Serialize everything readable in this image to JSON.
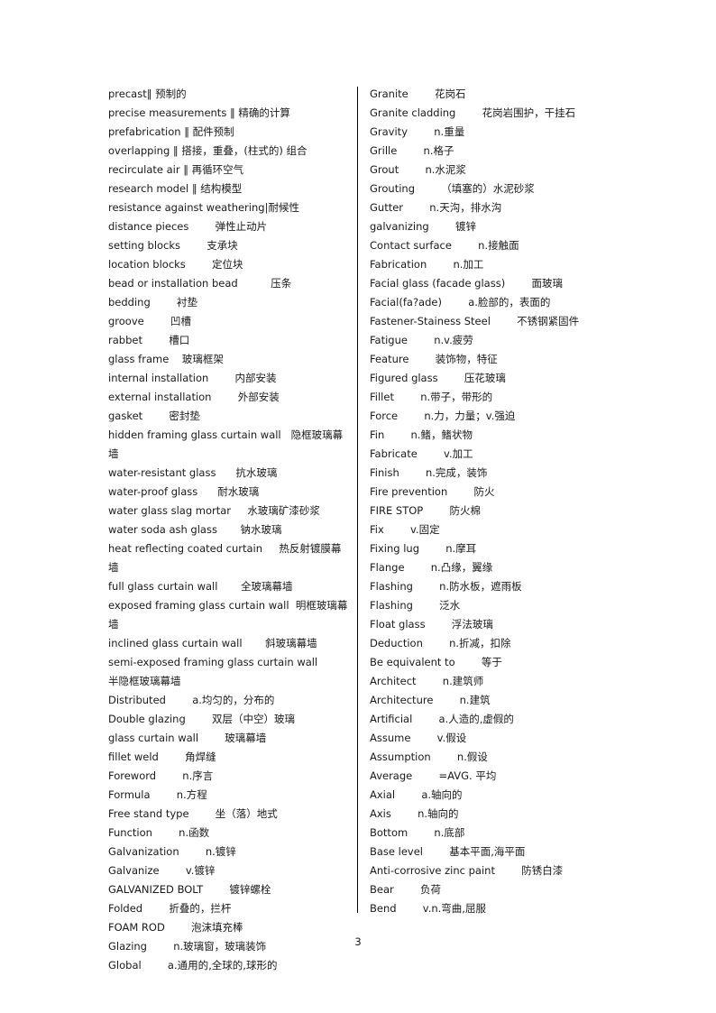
{
  "document": {
    "page_number": "3",
    "columns": {
      "left": [
        "precast‖ 预制的",
        "precise measurements ‖ 精确的计算",
        "prefabrication ‖ 配件预制",
        "overlapping ‖ 搭接，重叠，(柱式的) 组合",
        "recirculate air ‖ 再循环空气",
        "research model ‖ 结构模型",
        "resistance against weathering|耐候性",
        "distance pieces        弹性止动片",
        "setting blocks        支承块",
        "location blocks        定位块",
        "bead or installation bead          压条",
        "bedding        衬垫",
        "groove        凹槽",
        "rabbet        槽口",
        "glass frame    玻璃框架",
        "internal installation        内部安装",
        "external installation        外部安装",
        "gasket        密封垫",
        "hidden framing glass curtain wall   隐框玻璃幕墙",
        "water-resistant glass      抗水玻璃",
        "water-proof glass      耐水玻璃",
        "water glass slag mortar     水玻璃矿漆砂浆",
        "water soda ash glass       钠水玻璃",
        "heat reflecting coated curtain     热反射镀膜幕墙",
        "full glass curtain wall       全玻璃幕墙",
        "exposed framing glass curtain wall  明框玻璃幕墙",
        "inclined glass curtain wall       斜玻璃幕墙",
        "semi-exposed framing glass curtain wall          半隐框玻璃幕墙",
        "Distributed        a.均匀的，分布的",
        "Double glazing        双层（中空）玻璃",
        "glass curtain wall        玻璃幕墙",
        "fillet weld        角焊缝",
        "Foreword        n.序言",
        "Formula        n.方程",
        "Free stand type        坐（落）地式",
        "Function        n.函数",
        "Galvanization        n.镀锌",
        "Galvanize        v.镀锌",
        "GALVANIZED BOLT        镀锌螺栓",
        "Folded        折叠的，拦杆",
        "FOAM ROD        泡沫填充棒",
        "Glazing        n.玻璃窗，玻璃装饰",
        "Global        a.通用的,全球的,球形的"
      ],
      "right": [
        "Granite        花岗石",
        "Granite cladding        花岗岩围护，干挂石",
        "Gravity        n.重量",
        "Grille        n.格子",
        "Grout        n.水泥浆",
        "Grouting        （填塞的）水泥砂浆",
        "Gutter        n.天沟，排水沟",
        "galvanizing        镀锌",
        "Contact surface        n.接触面",
        "Fabrication        n.加工",
        "Facial glass (facade glass)        面玻璃",
        "Facial(fa?ade)        a.脸部的，表面的",
        "Fastener-Stainess Steel        不锈钢紧固件",
        "Fatigue        n.v.疲劳",
        "Feature        装饰物，特征",
        "Figured glass        压花玻璃",
        "Fillet        n.带子，带形的",
        "Force        n.力，力量；v.强迫",
        "Fin        n.鳍，鳍状物",
        "Fabricate        v.加工",
        "Finish        n.完成，装饰",
        "Fire prevention        防火",
        "FIRE STOP        防火棉",
        "Fix        v.固定",
        "Fixing lug        n.摩耳",
        "Flange        n.凸缘，翼缘",
        "Flashing        n.防水板，遮雨板",
        "Flashing        泛水",
        "Float glass        浮法玻璃",
        "Deduction        n.折减，扣除",
        "Be equivalent to        等于",
        "Architect        n.建筑师",
        "Architecture        n.建筑",
        "Artificial        a.人造的,虚假的",
        "Assume        v.假设",
        "Assumption        n.假设",
        "Average        =AVG. 平均",
        "Axial        a.轴向的",
        "Axis        n.轴向的",
        "Bottom        n.底部",
        "Base level        基本平面,海平面",
        "Anti-corrosive zinc paint        防锈白漆",
        "Bear        负荷",
        "Bend        v.n.弯曲,屈服"
      ]
    }
  }
}
